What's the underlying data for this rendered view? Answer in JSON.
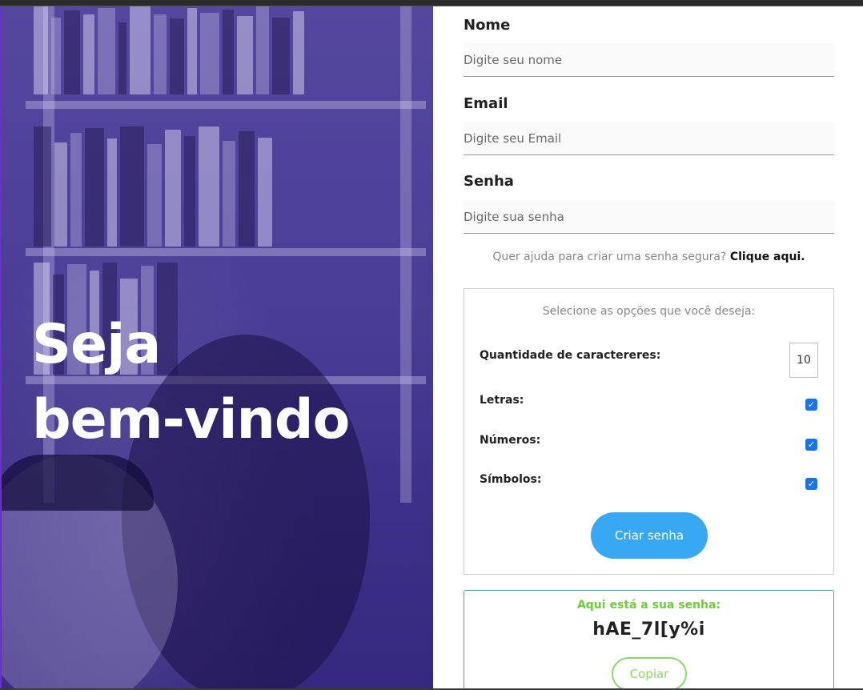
{
  "hero": {
    "title_line1": "Seja",
    "title_line2": "bem-vindo"
  },
  "form": {
    "name": {
      "label": "Nome",
      "placeholder": "Digite seu nome",
      "value": ""
    },
    "email": {
      "label": "Email",
      "placeholder": "Digite seu Email",
      "value": ""
    },
    "password": {
      "label": "Senha",
      "placeholder": "Digite sua senha",
      "value": ""
    },
    "help_text": "Quer ajuda para criar uma senha segura?",
    "help_link": "Clique aqui."
  },
  "options": {
    "title": "Selecione as opções que você deseja:",
    "quantity_label": "Quantidade de caractereres:",
    "quantity_value": "10",
    "letters_label": "Letras:",
    "letters_checked": true,
    "numbers_label": "Números:",
    "numbers_checked": true,
    "symbols_label": "Símbolos:",
    "symbols_checked": true,
    "create_button": "Criar senha"
  },
  "result": {
    "title": "Aqui está a sua senha:",
    "password": "hAE_7l[y%i",
    "copy_button": "Copiar"
  },
  "colors": {
    "hero_overlay": "#4a3d96",
    "create_button": "#38a8f5",
    "result_accent": "#6ccf3c",
    "result_border": "#2ab3b7",
    "checkbox": "#1a73e8"
  }
}
